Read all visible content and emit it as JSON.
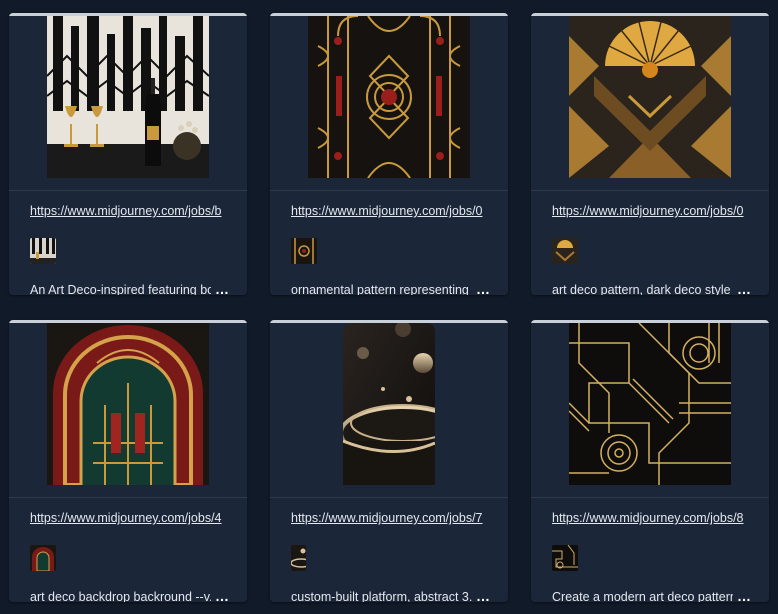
{
  "cards": [
    {
      "url": "https://www.midjourney.com/jobs/b",
      "prompt": "An Art Deco-inspired featuring bo...",
      "more_label": "…",
      "thumb_icon": "champagne-deco-image"
    },
    {
      "url": "https://www.midjourney.com/jobs/0",
      "prompt": "ornamental pattern representing t...",
      "more_label": "…",
      "thumb_icon": "ornamental-pattern-image"
    },
    {
      "url": "https://www.midjourney.com/jobs/0",
      "prompt": "art deco pattern, dark deco style ...",
      "more_label": "…",
      "thumb_icon": "fan-pattern-image"
    },
    {
      "url": "https://www.midjourney.com/jobs/4",
      "prompt": "art deco backdrop backround --v...",
      "more_label": "…",
      "thumb_icon": "arch-backdrop-image"
    },
    {
      "url": "https://www.midjourney.com/jobs/7",
      "prompt": "custom-built platform, abstract 3...",
      "more_label": "…",
      "thumb_icon": "platform-3d-image"
    },
    {
      "url": "https://www.midjourney.com/jobs/8",
      "prompt": "Create a modern art deco pattern...",
      "more_label": "…",
      "thumb_icon": "line-pattern-image"
    }
  ],
  "colors": {
    "background": "#111a28",
    "card": "#1b2638",
    "text": "#e4e8ef",
    "gold": "#c89a3c"
  }
}
